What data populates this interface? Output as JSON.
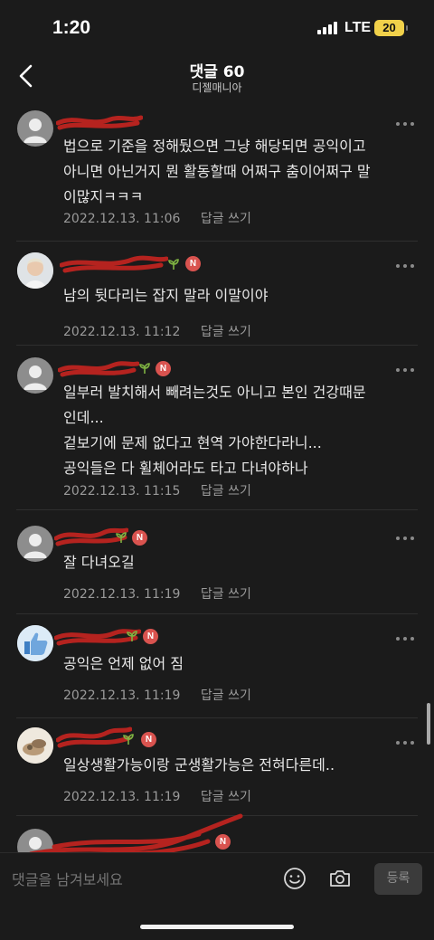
{
  "status": {
    "time": "1:20",
    "network": "LTE",
    "battery": "20"
  },
  "header": {
    "title": "댓글 60",
    "subtitle": "디젤매니아"
  },
  "comments": [
    {
      "author": "",
      "badge": "",
      "lines": [
        "법으로 기준을 정해뒀으면 그냥 해당되면 공익이고",
        "아니면 아닌거지 뭔 활동할때 어쩌구 춤이어쩌구 말",
        "이많지ㅋㅋㅋ"
      ],
      "date": "2022.12.13. 11:06",
      "reply": "답글 쓰기"
    },
    {
      "author": "",
      "badge": "N",
      "lines": [
        "남의 뒷다리는 잡지 말라 이말이야"
      ],
      "date": "2022.12.13. 11:12",
      "reply": "답글 쓰기"
    },
    {
      "author": "",
      "badge": "N",
      "lines": [
        "일부러 발치해서 빼려는것도 아니고 본인 건강때문",
        "인데...",
        "겉보기에 문제 없다고 현역 가야한다라니...",
        "공익들은 다 휠체어라도 타고 다녀야하나"
      ],
      "date": "2022.12.13. 11:15",
      "reply": "답글 쓰기"
    },
    {
      "author": "",
      "badge": "N",
      "lines": [
        "잘 다녀오길"
      ],
      "date": "2022.12.13. 11:19",
      "reply": "답글 쓰기"
    },
    {
      "author": "",
      "badge": "N",
      "lines": [
        "공익은 언제 없어 짐"
      ],
      "date": "2022.12.13. 11:19",
      "reply": "답글 쓰기"
    },
    {
      "author": "",
      "badge": "N",
      "lines": [
        "일상생활가능이랑 군생활가능은 전혀다른데.."
      ],
      "date": "2022.12.13. 11:19",
      "reply": "답글 쓰기"
    },
    {
      "author": "",
      "badge": "N",
      "lines": [],
      "date": "",
      "reply": ""
    }
  ],
  "input": {
    "placeholder": "댓글을 남겨보세요",
    "submit_label": "등록"
  },
  "colors": {
    "background": "#1b1b1b",
    "badge": "#d9534f",
    "redaction": "#b5231f",
    "sprout": "#7fb342"
  }
}
